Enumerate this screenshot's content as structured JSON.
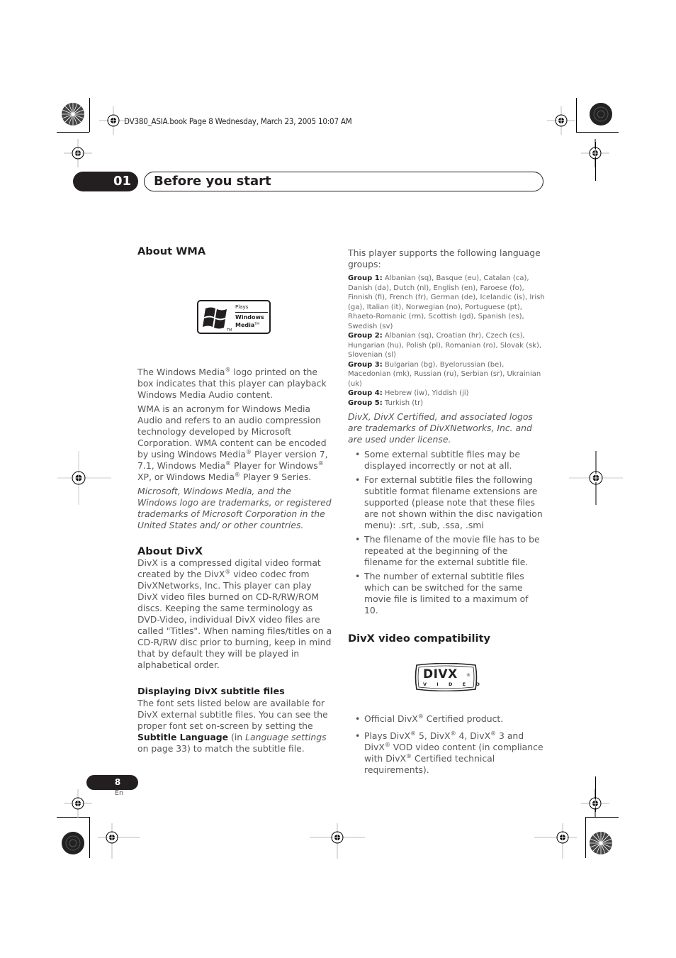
{
  "header": {
    "book_info": "DV380_ASIA.book  Page 8  Wednesday, March 23, 2005  10:07 AM",
    "chapter_number": "01",
    "chapter_title": "Before you start"
  },
  "left_column": {
    "about_wma": {
      "heading": "About WMA",
      "logo": {
        "plays": "Plays",
        "line1": "Windows",
        "line2": "Media",
        "tm": "TM",
        "flag_tm": "TM"
      },
      "para1": {
        "a": "The Windows Media",
        "reg": "®",
        "b": " logo printed on the box indicates that this player can playback Windows Media Audio content."
      },
      "para2": {
        "a": "WMA is an acronym for Windows Media Audio and refers to an audio compression technology developed by Microsoft Corporation. WMA content can be encoded by using Windows Media",
        "b": " Player version 7, 7.1, Windows Media",
        "c": " Player for Windows",
        "d": " XP, or Windows Media",
        "e": " Player 9 Series.",
        "reg": "®"
      },
      "trademark_note": "Microsoft, Windows Media, and the Windows logo are trademarks, or registered trademarks of Microsoft Corporation in the United States and/ or other countries."
    },
    "about_divx": {
      "heading": "About DivX",
      "para": {
        "a": "DivX is a compressed digital video format created by the DivX",
        "reg": "®",
        "b": " video codec from DivXNetworks, Inc. This player can play DivX video files burned on CD-R/RW/ROM discs. Keeping the same terminology as DVD-Video, individual DivX video files are called \"Titles\". When naming files/titles on a CD-R/RW disc prior to burning, keep in mind that by default they will be played in alphabetical order."
      }
    },
    "subtitle_section": {
      "heading": "Displaying DivX subtitle files",
      "a": "The font sets listed below are available for DivX external subtitle files. You can see the proper font set on-screen by setting the ",
      "bold": "Subtitle Language",
      "b": " (in ",
      "italic": "Language settings",
      "c": " on page 33) to match the subtitle file."
    }
  },
  "right_column": {
    "intro": "This player supports the following language groups:",
    "groups": [
      {
        "label": "Group 1:",
        "languages": " Albanian (sq), Basque (eu), Catalan (ca), Danish (da), Dutch (nl), English (en), Faroese (fo), Finnish (fi), French (fr), German (de), Icelandic (is), Irish (ga), Italian (it), Norwegian (no), Portuguese (pt), Rhaeto-Romanic (rm), Scottish (gd), Spanish (es), Swedish (sv)"
      },
      {
        "label": "Group 2:",
        "languages": " Albanian (sq), Croatian (hr), Czech (cs), Hungarian (hu), Polish (pl), Romanian (ro), Slovak (sk), Slovenian (sl)"
      },
      {
        "label": "Group 3:",
        "languages": " Bulgarian (bg), Byelorussian (be), Macedonian (mk), Russian (ru), Serbian (sr), Ukrainian (uk)"
      },
      {
        "label": "Group 4:",
        "languages": " Hebrew (iw), Yiddish (ji)"
      },
      {
        "label": "Group 5:",
        "languages": " Turkish (tr)"
      }
    ],
    "divx_trademark_note": "DivX, DivX Certified, and associated logos are trademarks of DivXNetworks, Inc. and are used under license.",
    "bullet_char": "•",
    "subtitle_notes": [
      "Some external subtitle files may be displayed incorrectly or not at all.",
      "For external subtitle files the following subtitle format filename extensions are supported (please note that these files are not shown within the disc navigation menu): .srt, .sub, .ssa, .smi",
      "The filename of the movie file has to be repeated at the beginning of the filename for the external subtitle file.",
      "The number of external subtitle files which can be switched for the same movie file is limited to a maximum of 10."
    ],
    "compat": {
      "heading": "DivX video compatibility",
      "logo": {
        "main": "DIVX",
        "sub": "V I D E O",
        "reg": "®"
      },
      "reg": "®",
      "item1": {
        "a": "Official DivX",
        "b": " Certified product."
      },
      "item2": {
        "a": "Plays DivX",
        "b": " 5, DivX",
        "c": " 4, DivX",
        "d": " 3 and DivX",
        "e": " VOD video content (in compliance with DivX",
        "f": " Certified technical requirements)."
      }
    }
  },
  "footer": {
    "page_number": "8",
    "language": "En"
  }
}
